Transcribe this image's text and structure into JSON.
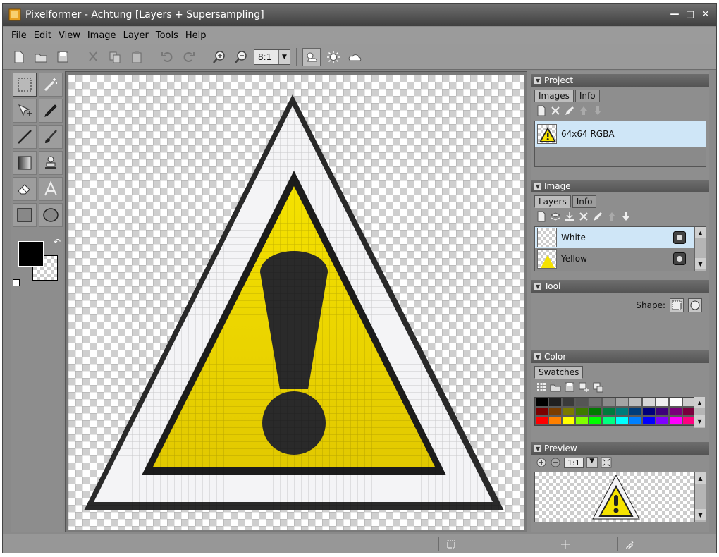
{
  "window": {
    "title": "Pixelformer - Achtung [Layers + Supersampling]",
    "icons": [
      "app-icon",
      "minimize-icon",
      "maximize-icon",
      "close-icon"
    ]
  },
  "menu": {
    "items": [
      {
        "label": "File",
        "hotkey": "F"
      },
      {
        "label": "Edit",
        "hotkey": "E"
      },
      {
        "label": "View",
        "hotkey": "V"
      },
      {
        "label": "Image",
        "hotkey": "I"
      },
      {
        "label": "Layer",
        "hotkey": "L"
      },
      {
        "label": "Tools",
        "hotkey": "T"
      },
      {
        "label": "Help",
        "hotkey": "H"
      }
    ]
  },
  "toolbar": {
    "zoom_value": "8:1",
    "icons": [
      "new-icon",
      "open-icon",
      "save-icon",
      "cut-icon",
      "copy-icon",
      "paste-icon",
      "undo-icon",
      "redo-icon",
      "zoom-in-icon",
      "zoom-out-icon",
      "lighting-icon",
      "sun-icon",
      "cloud-icon"
    ]
  },
  "tools": {
    "icons": [
      "rect-select-icon",
      "magic-wand-icon",
      "move-icon",
      "pen-icon",
      "line-icon",
      "brush-icon",
      "gradient-icon",
      "stamp-icon",
      "eraser-icon",
      "text-icon",
      "rectangle-icon",
      "ellipse-icon"
    ],
    "foreground_color": "#000000"
  },
  "panels": {
    "project": {
      "title": "Project",
      "tabs": [
        "Images",
        "Info"
      ],
      "items": [
        {
          "label": "64x64 RGBA"
        }
      ]
    },
    "image": {
      "title": "Image",
      "tabs": [
        "Layers",
        "Info"
      ],
      "layers": [
        {
          "label": "White"
        },
        {
          "label": "Yellow"
        }
      ]
    },
    "tool": {
      "title": "Tool",
      "shape_label": "Shape:"
    },
    "color": {
      "title": "Color",
      "tabs": [
        "Swatches"
      ],
      "swatches": [
        "#000000",
        "#202020",
        "#3a3a3a",
        "#555555",
        "#707070",
        "#8a8a8a",
        "#a4a4a4",
        "#bdbdbd",
        "#d6d6d6",
        "#efefef",
        "#ffffff",
        "#cccccc",
        "#7a0000",
        "#7a3d00",
        "#7a7a00",
        "#3d7a00",
        "#007a00",
        "#007a3d",
        "#007a7a",
        "#003d7a",
        "#00007a",
        "#3d007a",
        "#7a007a",
        "#7a003d",
        "#ff0000",
        "#ff8000",
        "#ffff00",
        "#80ff00",
        "#00ff00",
        "#00ff80",
        "#00ffff",
        "#0080ff",
        "#0000ff",
        "#8000ff",
        "#ff00ff",
        "#ff0080"
      ]
    },
    "preview": {
      "title": "Preview",
      "zoom_value": "1:1"
    }
  },
  "colors": {
    "warning_yellow": "#f5e200",
    "warning_black": "#1c1c1c",
    "selection_blue": "#cfe6f7"
  }
}
